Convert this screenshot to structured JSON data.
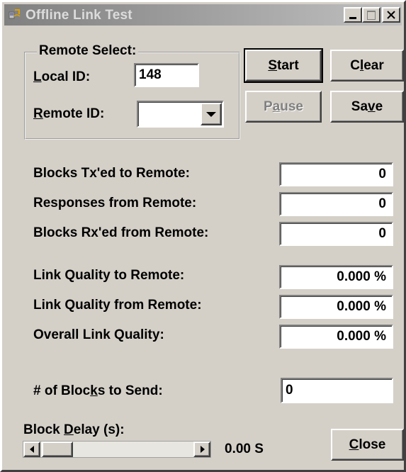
{
  "window": {
    "title": "Offline Link Test",
    "minimize_icon": "minimize-icon",
    "maximize_icon": "maximize-icon",
    "close_icon": "close-icon"
  },
  "remote_select": {
    "group_label": "Remote Select:",
    "local_id_label": {
      "pre": "",
      "key": "L",
      "post": "ocal ID:"
    },
    "local_id_value": "148",
    "remote_id_label": {
      "pre": "",
      "key": "R",
      "post": "emote ID:"
    },
    "remote_id_value": ""
  },
  "buttons": {
    "start": {
      "pre": "",
      "key": "S",
      "post": "tart"
    },
    "clear": {
      "pre": "C",
      "key": "l",
      "post": "ear"
    },
    "pause": {
      "pre": "P",
      "key": "a",
      "post": "use"
    },
    "save": {
      "pre": "Sa",
      "key": "v",
      "post": "e"
    },
    "close": {
      "pre": "",
      "key": "C",
      "post": "lose"
    }
  },
  "stats": [
    {
      "label": "Blocks Tx'ed to Remote:",
      "value": "0"
    },
    {
      "label": "Responses from Remote:",
      "value": "0"
    },
    {
      "label": "Blocks Rx'ed from Remote:",
      "value": "0"
    },
    {
      "label": "Link Quality to Remote:",
      "value": "0.000 %"
    },
    {
      "label": "Link Quality from Remote:",
      "value": "0.000 %"
    },
    {
      "label": "Overall Link Quality:",
      "value": "0.000 %"
    }
  ],
  "blocks_to_send": {
    "label": {
      "pre": "# of Bloc",
      "key": "k",
      "post": "s to Send:"
    },
    "value": "0"
  },
  "block_delay": {
    "label": {
      "pre": "Block ",
      "key": "D",
      "post": "elay (s):"
    },
    "readout": "0.00 S",
    "slider_fraction": 0
  }
}
